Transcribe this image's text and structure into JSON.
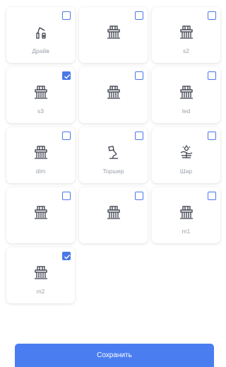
{
  "devices": [
    {
      "label": "Драйв",
      "icon": "lamp-device-icon",
      "checked": false
    },
    {
      "label": "",
      "icon": "house-icon",
      "checked": false
    },
    {
      "label": "s2",
      "icon": "house-icon",
      "checked": false
    },
    {
      "label": "s3",
      "icon": "house-icon",
      "checked": true
    },
    {
      "label": "",
      "icon": "house-icon",
      "checked": false
    },
    {
      "label": "led",
      "icon": "house-icon",
      "checked": false
    },
    {
      "label": "dim",
      "icon": "house-icon",
      "checked": false
    },
    {
      "label": "Торшер",
      "icon": "floor-lamp-icon",
      "checked": false
    },
    {
      "label": "Шар",
      "icon": "ball-lamp-icon",
      "checked": false
    },
    {
      "label": "",
      "icon": "house-icon",
      "checked": false
    },
    {
      "label": "",
      "icon": "house-icon",
      "checked": false
    },
    {
      "label": "m1",
      "icon": "house-icon",
      "checked": false
    },
    {
      "label": "m2",
      "icon": "house-icon",
      "checked": true
    }
  ],
  "save_label": "Сохранить",
  "colors": {
    "accent": "#4a7df0",
    "icon": "#3a3f4a",
    "label": "#9aa0a8"
  }
}
